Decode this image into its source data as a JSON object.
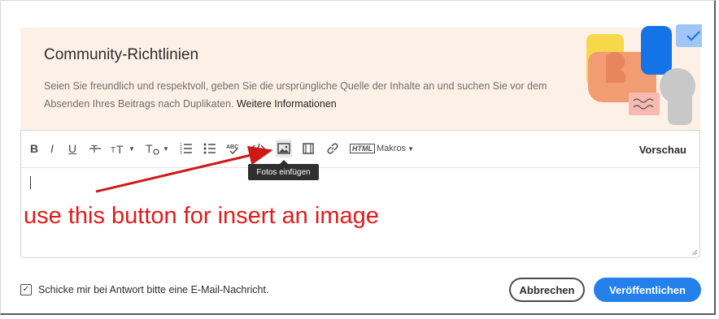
{
  "guidelines": {
    "title": "Community-Richtlinien",
    "text": "Seien Sie freundlich und respektvoll, geben Sie die ursprüngliche Quelle der Inhalte an und suchen Sie vor dem Absenden Ihres Beitrags nach Duplikaten.",
    "link": "Weitere Informationen"
  },
  "toolbar": {
    "bold": "B",
    "italic": "I",
    "underline": "U",
    "html_label": "HTML",
    "macros": "Makros",
    "preview": "Vorschau",
    "tooltip": "Fotos einfügen"
  },
  "annotation": "use this button for insert an image",
  "footer": {
    "checkbox_label": "Schicke mir bei Antwort bitte eine E-Mail-Nachricht.",
    "checkbox_checked": true,
    "cancel": "Abbrechen",
    "publish": "Veröffentlichen"
  },
  "colors": {
    "accent": "#2680eb",
    "annotation": "#e21b1b",
    "banner_bg": "#fdf1e7"
  }
}
